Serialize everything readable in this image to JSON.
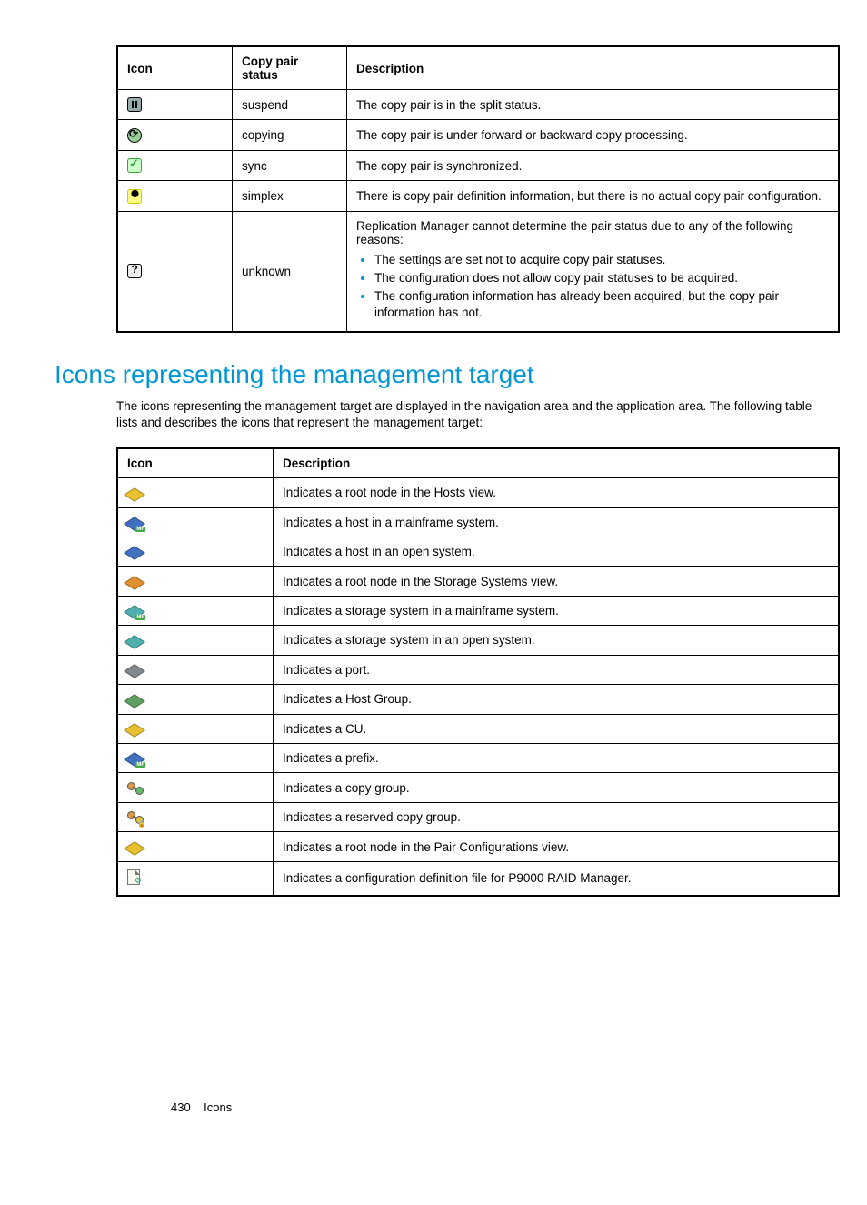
{
  "copy_pair_table": {
    "headers": {
      "icon": "Icon",
      "status": "Copy pair status",
      "description": "Description"
    },
    "rows": [
      {
        "icon": "pause-icon",
        "status": "suspend",
        "description": "The copy pair is in the split status."
      },
      {
        "icon": "refresh-icon",
        "status": "copying",
        "description": "The copy pair is under forward or backward copy processing."
      },
      {
        "icon": "check-icon",
        "status": "sync",
        "description": "The copy pair is synchronized."
      },
      {
        "icon": "simplex-icon",
        "status": "simplex",
        "description": "There is copy pair definition information, but there is no actual copy pair configuration."
      },
      {
        "icon": "unknown-icon",
        "status": "unknown",
        "description_intro": "Replication Manager cannot determine the pair status due to any of the following reasons:",
        "reasons": [
          "The settings are set not to acquire copy pair statuses.",
          "The configuration does not allow copy pair statuses to be acquired.",
          "The configuration information has already been acquired, but the copy pair information has not."
        ]
      }
    ]
  },
  "section_heading": "Icons representing the management target",
  "section_intro": "The icons representing the management target are displayed in the navigation area and the application area. The following table lists and describes the icons that represent the management target:",
  "management_table": {
    "headers": {
      "icon": "Icon",
      "description": "Description"
    },
    "rows": [
      {
        "icon": "hosts-root-icon",
        "description": "Indicates a root node in the Hosts view."
      },
      {
        "icon": "host-mainframe-icon",
        "description": "Indicates a host in a mainframe system."
      },
      {
        "icon": "host-open-icon",
        "description": "Indicates a host in an open system."
      },
      {
        "icon": "storage-root-icon",
        "description": "Indicates a root node in the Storage Systems view."
      },
      {
        "icon": "storage-mainframe-icon",
        "description": "Indicates a storage system in a mainframe system."
      },
      {
        "icon": "storage-open-icon",
        "description": "Indicates a storage system in an open system."
      },
      {
        "icon": "port-icon",
        "description": "Indicates a port."
      },
      {
        "icon": "host-group-icon",
        "description": "Indicates a Host Group."
      },
      {
        "icon": "cu-icon",
        "description": "Indicates a CU."
      },
      {
        "icon": "prefix-icon",
        "description": "Indicates a prefix."
      },
      {
        "icon": "copy-group-icon",
        "description": "Indicates a copy group."
      },
      {
        "icon": "reserved-copy-group-icon",
        "description": "Indicates a reserved copy group."
      },
      {
        "icon": "pair-config-root-icon",
        "description": "Indicates a root node in the Pair Configurations view."
      },
      {
        "icon": "config-def-file-icon",
        "description": "Indicates a configuration definition file for P9000 RAID Manager."
      }
    ]
  },
  "footer": {
    "page_number": "430",
    "section": "Icons"
  }
}
